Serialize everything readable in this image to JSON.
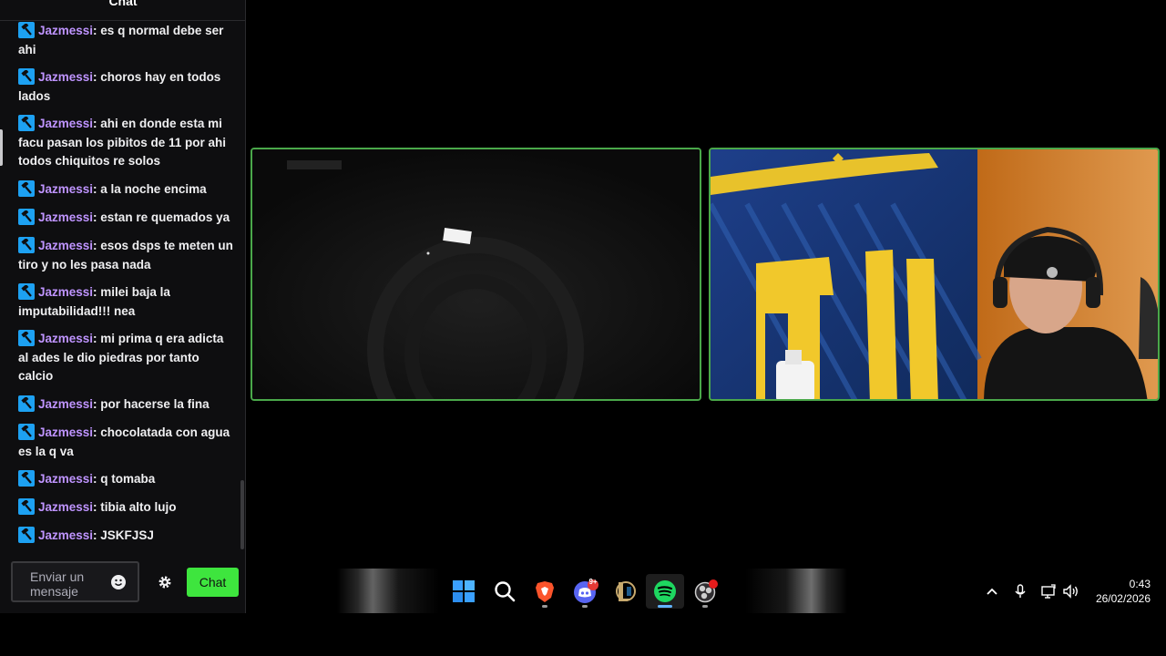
{
  "chat": {
    "title": "Chat",
    "messages": [
      {
        "user": "Jazmessi",
        "text": "es q normal debe ser ahi"
      },
      {
        "user": "Jazmessi",
        "text": "choros hay en todos lados"
      },
      {
        "user": "Jazmessi",
        "text": "ahi en donde esta mi facu pasan los pibitos de 11 por ahi todos chiquitos re solos"
      },
      {
        "user": "Jazmessi",
        "text": "a la noche encima"
      },
      {
        "user": "Jazmessi",
        "text": "estan re quemados ya"
      },
      {
        "user": "Jazmessi",
        "text": "esos dsps te meten un tiro y no les pasa nada"
      },
      {
        "user": "Jazmessi",
        "text": "milei baja la imputabilidad!!! nea"
      },
      {
        "user": "Jazmessi",
        "text": "mi prima q era adicta al ades le dio piedras por tanto calcio"
      },
      {
        "user": "Jazmessi",
        "text": "por hacerse la fina"
      },
      {
        "user": "Jazmessi",
        "text": "chocolatada con agua es la q va"
      },
      {
        "user": "Jazmessi",
        "text": "q tomaba"
      },
      {
        "user": "Jazmessi",
        "text": "tibia alto lujo"
      },
      {
        "user": "Jazmessi",
        "text": "JSKFJSJ"
      }
    ],
    "input_placeholder": "Enviar un mensaje",
    "send_label": "Chat",
    "badge_icon": "hammer-icon",
    "user_color": "#bf94ff",
    "send_color": "#3ee53e"
  },
  "taskbar": {
    "apps": [
      {
        "name": "windows-start-icon"
      },
      {
        "name": "search-icon"
      },
      {
        "name": "brave-browser-icon"
      },
      {
        "name": "discord-icon",
        "badge": "9+"
      },
      {
        "name": "league-of-legends-icon"
      },
      {
        "name": "spotify-icon"
      },
      {
        "name": "obs-studio-icon"
      }
    ],
    "tray": [
      "chevron-up-icon",
      "microphone-icon",
      "network-icon",
      "speaker-icon"
    ],
    "time": "0:43",
    "date": "26/02/2026"
  }
}
